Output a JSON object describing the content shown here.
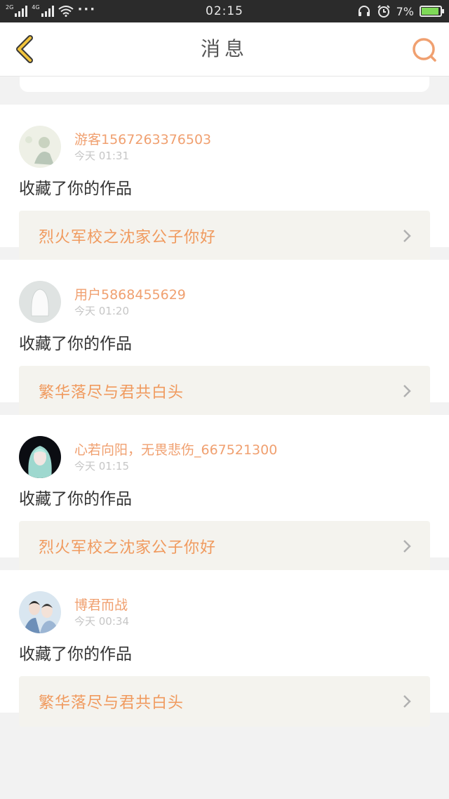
{
  "status_bar": {
    "net_left": "2G",
    "net_right": "4G",
    "dots": "···",
    "time": "02:15",
    "battery": "7%"
  },
  "header": {
    "title": "消息",
    "back_icon": "chevron-left-icon",
    "search_icon": "search-icon"
  },
  "colors": {
    "accent": "#f0a070",
    "work_title": "#f09a5e",
    "back_arrow": "#f2c43c",
    "card_bg": "#f4f3ee"
  },
  "messages": [
    {
      "user": "游客1567263376503",
      "time": "今天 01:31",
      "action": "收藏了你的作品",
      "work": "烈火军校之沈家公子你好"
    },
    {
      "user": "用户5868455629",
      "time": "今天 01:20",
      "action": "收藏了你的作品",
      "work": "繁华落尽与君共白头"
    },
    {
      "user": "心若向阳，无畏悲伤_667521300",
      "time": "今天 01:15",
      "action": "收藏了你的作品",
      "work": "烈火军校之沈家公子你好"
    },
    {
      "user": "博君而战",
      "time": "今天 00:34",
      "action": "收藏了你的作品",
      "work": "繁华落尽与君共白头"
    }
  ]
}
